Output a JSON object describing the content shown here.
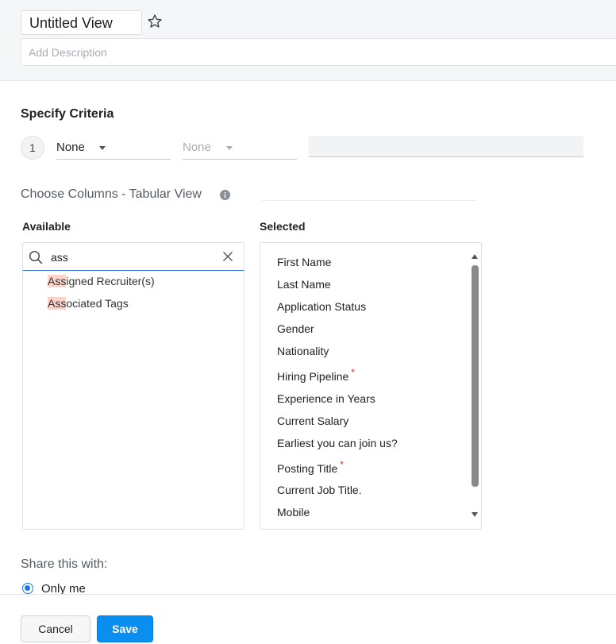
{
  "header": {
    "view_name": "Untitled View",
    "description_placeholder": "Add Description"
  },
  "criteria": {
    "title": "Specify Criteria",
    "row_number": "1",
    "field_select": "None",
    "operator_select": "None"
  },
  "columns": {
    "title": "Choose Columns - Tabular View",
    "available_label": "Available",
    "selected_label": "Selected",
    "search_value": "ass",
    "available_items": [
      {
        "highlight": "Ass",
        "rest": "igned Recruiter(s)"
      },
      {
        "highlight": "Ass",
        "rest": "ociated Tags"
      }
    ],
    "selected_items": [
      {
        "label": "First Name",
        "required": ""
      },
      {
        "label": "Last Name",
        "required": ""
      },
      {
        "label": "Application Status",
        "required": ""
      },
      {
        "label": "Gender",
        "required": ""
      },
      {
        "label": "Nationality",
        "required": ""
      },
      {
        "label": "Hiring Pipeline",
        "required": "*"
      },
      {
        "label": "Experience in Years",
        "required": ""
      },
      {
        "label": "Current Salary",
        "required": ""
      },
      {
        "label": "Earliest you can join us?",
        "required": ""
      },
      {
        "label": "Posting Title",
        "required": "*"
      },
      {
        "label": "Current Job Title.",
        "required": ""
      },
      {
        "label": "Mobile",
        "required": ""
      }
    ]
  },
  "share": {
    "title": "Share this with:",
    "option_label": "Only me"
  },
  "footer": {
    "cancel_label": "Cancel",
    "save_label": "Save"
  },
  "colors": {
    "primary": "#0a8ef0",
    "highlight": "#fbd3c8",
    "required": "#e0332a"
  }
}
